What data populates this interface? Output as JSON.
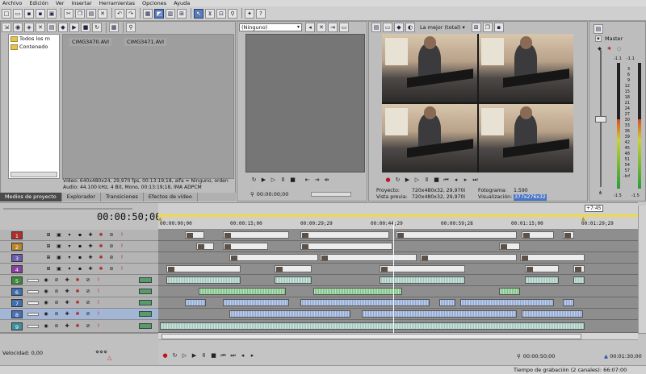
{
  "menu": [
    "Archivo",
    "Edición",
    "Ver",
    "Insertar",
    "Herramientas",
    "Opciones",
    "Ayuda"
  ],
  "explorer": {
    "tree": [
      "Todos los m",
      "Contenedo"
    ],
    "clips": [
      "CIMG3470.AVI",
      "CIMG3471.AVI"
    ],
    "info_video": "Vídeo: 640x480x24, 29,970 fps, 00:13:19;18, alfa = Ninguno, orden",
    "info_audio": "Audio: 44.100 kHz, 4 Bit, Mono, 00:13:19;18, IMA ADPCM",
    "tabs": [
      "Medios de proyecto",
      "Explorador",
      "Transiciones",
      "Efectos de vídeo"
    ]
  },
  "trimmer": {
    "select": "(Ninguno)",
    "timecode": "00:00:00;00"
  },
  "preview": {
    "quality": "La mejor (total)",
    "proyecto_label": "Proyecto:",
    "proyecto_val": "720x480x32, 29,970i",
    "vista_label": "Vista previa:",
    "vista_val": "720x480x32, 29,970i",
    "fotograma_label": "Fotograma:",
    "fotograma_val": "1.590",
    "visual_label": "Visualización:",
    "visual_val": "377x276x32"
  },
  "mixer": {
    "master": "Master",
    "scale": [
      "-1.1",
      "-1.1",
      "3",
      "6",
      "9",
      "12",
      "15",
      "18",
      "21",
      "24",
      "27",
      "30",
      "33",
      "36",
      "39",
      "42",
      "45",
      "48",
      "51",
      "54",
      "57",
      "-Inf"
    ],
    "bottom_left": "-1.5",
    "bottom_right": "-1.5"
  },
  "timeline": {
    "timecode": "00:00:50;00",
    "ruler": [
      "00:00:00;00",
      "00:00:15;00",
      "00:00:29;29",
      "00:00:44;29",
      "00:00:59;28",
      "00:01:15;00",
      "00:01:29;29"
    ],
    "marker": "+7:45",
    "speed": "Velocidad: 0,00",
    "time_right": "00:00:50;00",
    "time_far": "00:01:30;00",
    "status": "Tiempo de grabación (2 canales): 66:07:00",
    "tracks": [
      "1",
      "2",
      "3",
      "4",
      "5",
      "6",
      "7",
      "8",
      "9"
    ]
  },
  "colors": {
    "track_colors": [
      "#b22c2c",
      "#b8862a",
      "#6a5ab0",
      "#8a3fa0",
      "#3d8a3d",
      "#3f6fb0",
      "#3f6fb0",
      "#4a6fb4",
      "#3f8fa0"
    ]
  }
}
